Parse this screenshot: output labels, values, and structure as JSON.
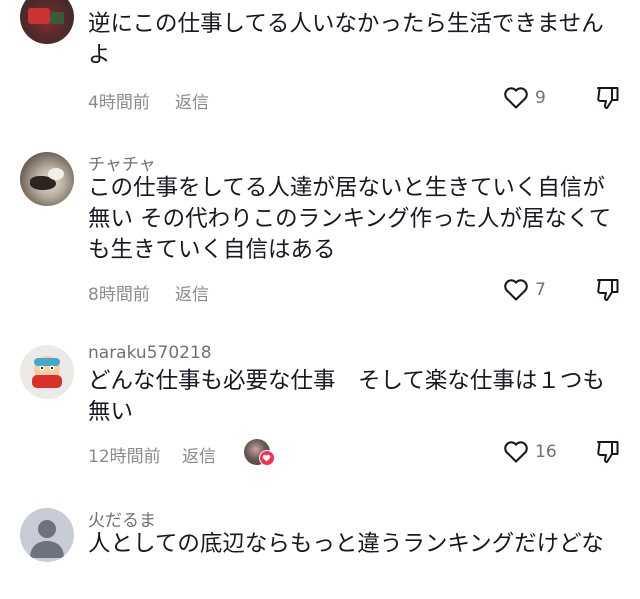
{
  "comments": [
    {
      "username": "",
      "text": "逆にこの仕事してる人いなかったら生活できませんよ",
      "time": "4時間前",
      "reply_label": "返信",
      "likes": "9"
    },
    {
      "username": "チャチャ",
      "text": "この仕事をしてる人達が居ないと生きていく自信が無い その代わりこのランキング作った人が居なくても生きていく自信はある",
      "time": "8時間前",
      "reply_label": "返信",
      "likes": "7"
    },
    {
      "username": "naraku570218",
      "text": "どんな仕事も必要な仕事　そして楽な仕事は１つも無い",
      "time": "12時間前",
      "reply_label": "返信",
      "likes": "16"
    },
    {
      "username": "火だるま",
      "text": "人としての底辺ならもっと違うランキングだけどな",
      "time": "",
      "reply_label": "",
      "likes": ""
    }
  ],
  "icons": {
    "like": "heart-outline-icon",
    "dislike": "thumbs-down-icon",
    "creator_like": "heart-badge-icon"
  },
  "colors": {
    "text": "#161823",
    "muted": "#8a8b91",
    "accent": "#fe2c55"
  }
}
